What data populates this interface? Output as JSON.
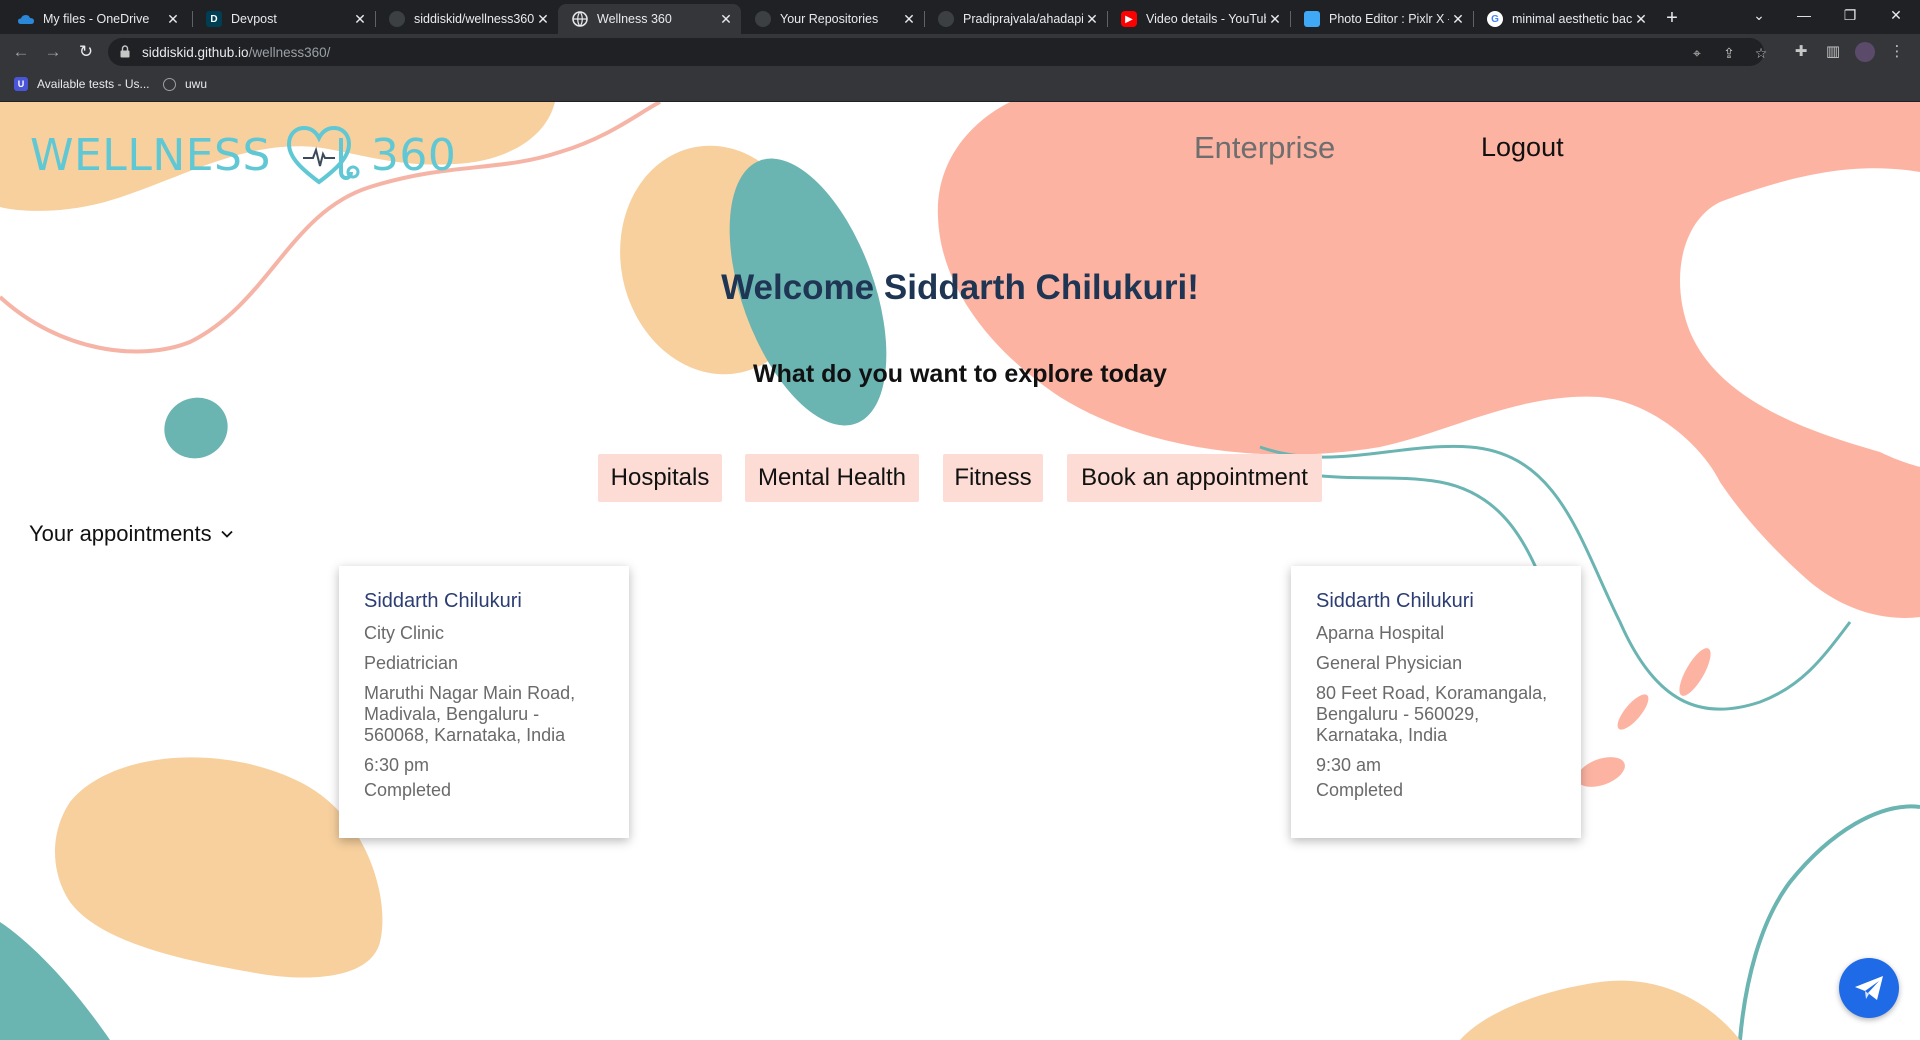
{
  "browser": {
    "tabs": [
      {
        "title": "My files - OneDrive",
        "icon": "onedrive-icon",
        "color": "#2b88d8"
      },
      {
        "title": "Devpost",
        "icon": "devpost-icon",
        "color": "#003e54"
      },
      {
        "title": "siddiskid/wellness360",
        "icon": "github-icon",
        "color": "#24292f"
      },
      {
        "title": "Wellness 360",
        "icon": "globe-icon",
        "color": "#e8eaed"
      },
      {
        "title": "Your Repositories",
        "icon": "github-icon",
        "color": "#24292f"
      },
      {
        "title": "Pradiprajvala/ahadapi",
        "icon": "github-icon",
        "color": "#24292f"
      },
      {
        "title": "Video details - YouTube",
        "icon": "youtube-icon",
        "color": "#ff0000"
      },
      {
        "title": "Photo Editor : Pixlr X - free",
        "icon": "pixlr-icon",
        "color": "#3fa9f5"
      },
      {
        "title": "minimal aesthetic background",
        "icon": "google-icon",
        "color": "#ffffff"
      }
    ],
    "url_host": "siddiskid.github.io",
    "url_path": "/wellness360/",
    "bookmarks": [
      {
        "label": "Available tests - Us...",
        "icon": "udemy-icon"
      },
      {
        "label": "uwu",
        "icon": "globe-icon"
      }
    ]
  },
  "header": {
    "logo_left": "WELLNESS",
    "logo_right": "360",
    "nav_enterprise": "Enterprise",
    "nav_logout": "Logout"
  },
  "main": {
    "welcome": "Welcome Siddarth Chilukuri!",
    "subtitle": "What do you want to explore today",
    "categories": [
      "Hospitals",
      "Mental Health",
      "Fitness",
      "Book an appointment"
    ],
    "appointments_label": "Your appointments"
  },
  "appointments": [
    {
      "name": "Siddarth Chilukuri",
      "hospital": "City Clinic",
      "specialty": "Pediatrician",
      "address": "Maruthi Nagar Main Road, Madivala, Bengaluru - 560068, Karnataka, India",
      "time": "6:30 pm",
      "status": "Completed"
    },
    {
      "name": "Siddarth Chilukuri",
      "hospital": "Aparna Hospital",
      "specialty": "General Physician",
      "address": "80 Feet Road, Koramangala, Bengaluru - 560029, Karnataka, India",
      "time": "9:30 am",
      "status": "Completed"
    }
  ],
  "colors": {
    "logo_teal": "#5fc8d4",
    "salmon": "#fdb3a2",
    "peach": "#f7d09e",
    "teal": "#6ab4b2",
    "button_bg": "#fcdcd4",
    "welcome_navy": "#1e3553",
    "fab_blue": "#1f6ae6"
  }
}
